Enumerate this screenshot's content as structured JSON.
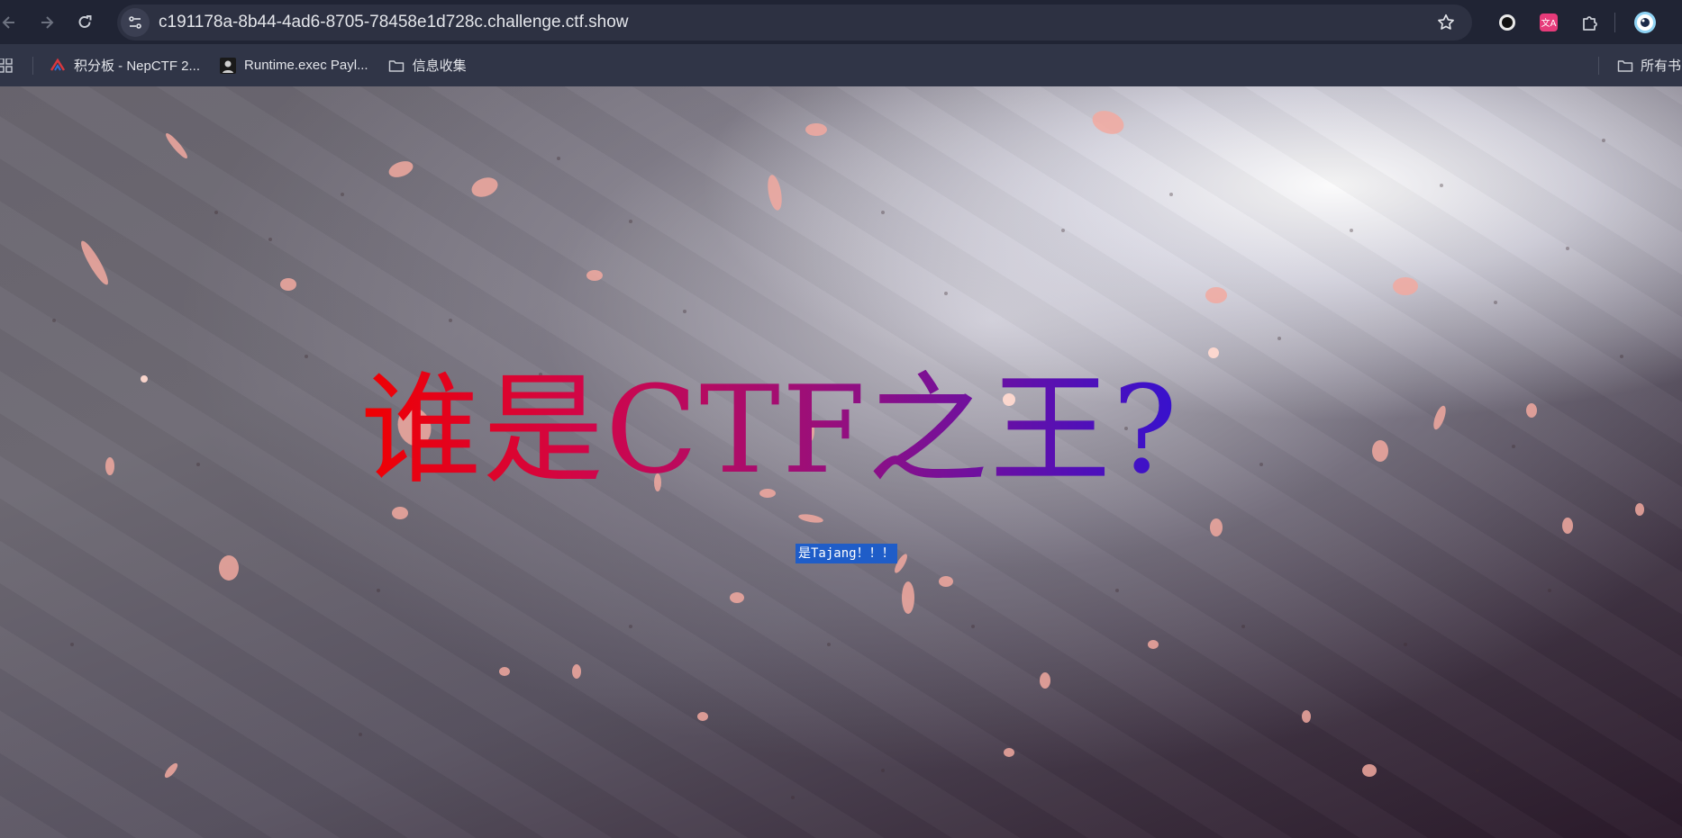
{
  "browser": {
    "url": "c191178a-8b44-4ad6-8705-78458e1d728c.challenge.ctf.show",
    "bookmarks": [
      {
        "label": "积分板 - NepCTF 2...",
        "icon": "nepctf-logo-icon"
      },
      {
        "label": "Runtime.exec Payl...",
        "icon": "avatar-icon"
      },
      {
        "label": "信息收集",
        "icon": "folder-icon"
      }
    ],
    "bookmarks_right_label": "所有书"
  },
  "page": {
    "title": "谁是CTF之王?",
    "selected_text": "是Tajang！！！"
  },
  "colors": {
    "title_gradient_start": "#f00000",
    "title_gradient_end": "#1a12e6",
    "selection": "#1f5dc8"
  }
}
